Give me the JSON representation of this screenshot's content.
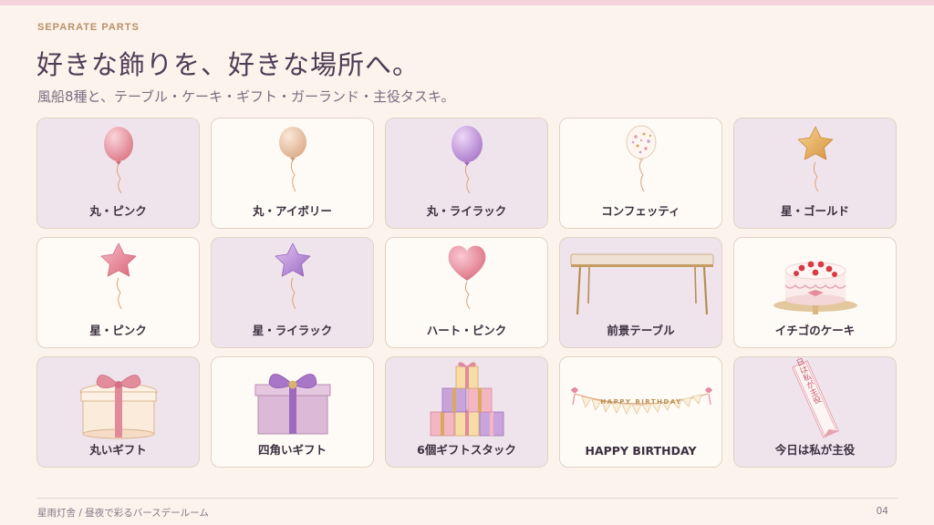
{
  "header": {
    "eyebrow": "SEPARATE PARTS",
    "title": "好きな飾りを、好きな場所へ。",
    "subtitle": "風船8種と、テーブル・ケーキ・ギフト・ガーランド・主役タスキ。"
  },
  "cards": [
    {
      "label": "丸・ピンク",
      "icon": "pink-round-balloon-icon"
    },
    {
      "label": "丸・アイボリー",
      "icon": "ivory-round-balloon-icon"
    },
    {
      "label": "丸・ライラック",
      "icon": "lilac-round-balloon-icon"
    },
    {
      "label": "コンフェッティ",
      "icon": "confetti-balloon-icon"
    },
    {
      "label": "星・ゴールド",
      "icon": "gold-star-balloon-icon"
    },
    {
      "label": "星・ピンク",
      "icon": "pink-star-balloon-icon"
    },
    {
      "label": "星・ライラック",
      "icon": "lilac-star-balloon-icon"
    },
    {
      "label": "ハート・ピンク",
      "icon": "pink-heart-balloon-icon"
    },
    {
      "label": "前景テーブル",
      "icon": "table-icon"
    },
    {
      "label": "イチゴのケーキ",
      "icon": "strawberry-cake-icon"
    },
    {
      "label": "丸いギフト",
      "icon": "round-gift-box-icon"
    },
    {
      "label": "四角いギフト",
      "icon": "square-gift-box-icon"
    },
    {
      "label": "6個ギフトスタック",
      "icon": "gift-stack-icon"
    },
    {
      "label": "HAPPY BIRTHDAY",
      "icon": "birthday-garland-icon"
    },
    {
      "label": "今日は私が主役",
      "icon": "sash-icon"
    }
  ],
  "garland_text": "HAPPY BIRTHDAY",
  "sash_text": "今日は私が主役",
  "footer": {
    "left": "星雨灯舎 / 昼夜で彩るバースデールーム",
    "page": "04"
  },
  "colors": {
    "background": "#fcf3ec",
    "card_lilac": "#f0e4ec",
    "card_cream": "#fefbf6",
    "accent_gold": "#b8916a"
  }
}
